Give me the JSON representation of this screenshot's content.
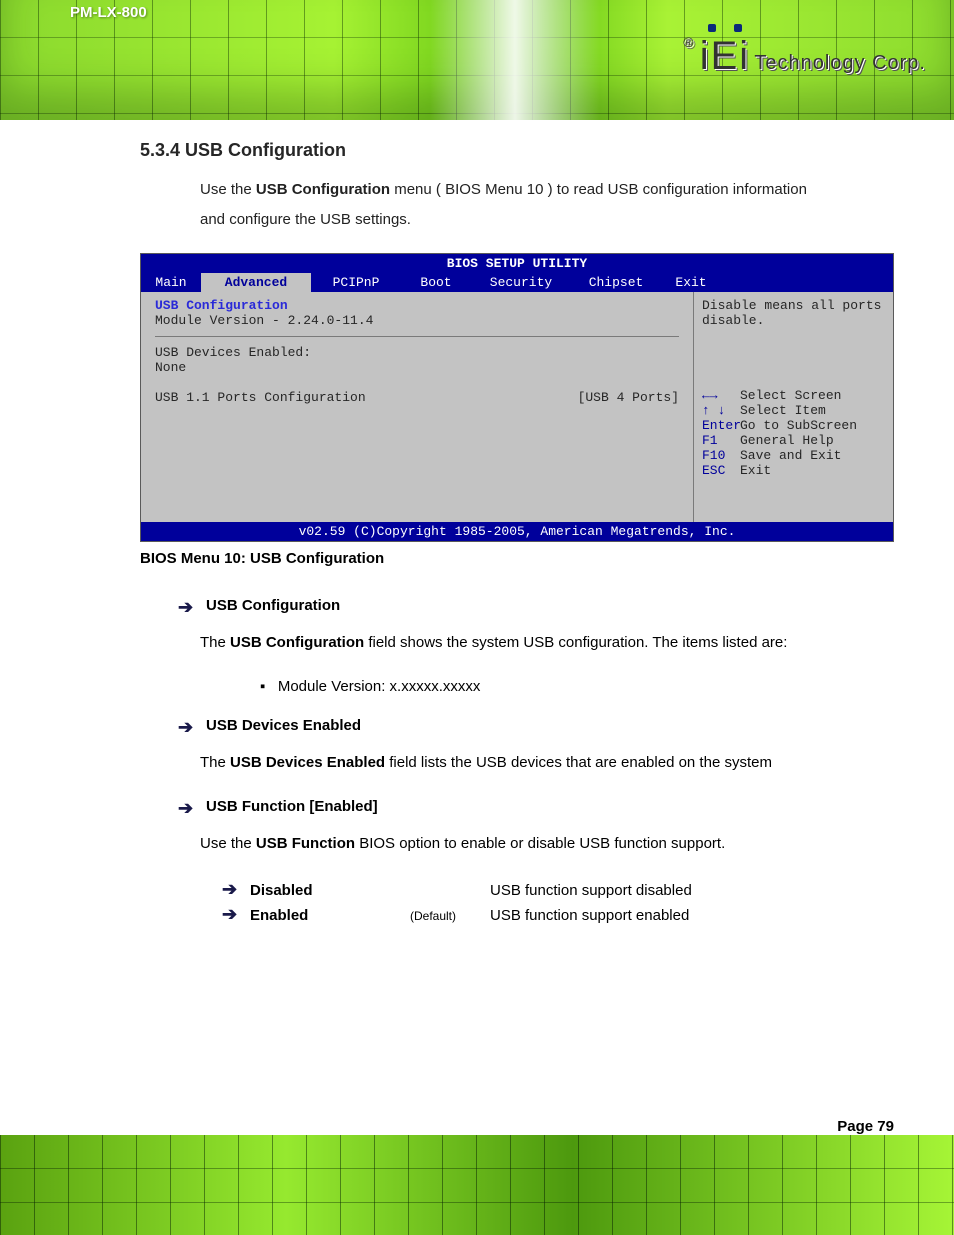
{
  "header": {
    "product": "PM-LX-800",
    "logo_reg": "®",
    "logo_mark": "iEi",
    "logo_tag": "Technology Corp."
  },
  "section_heading": "5.3.4 USB Configuration",
  "intro_pre": "Use the ",
  "intro_bold": "USB Configuration",
  "intro_mid": " menu (",
  "intro_ref": "BIOS Menu 10",
  "intro_post": ") to read USB configuration information and configure the USB settings.",
  "bios": {
    "title": "BIOS SETUP UTILITY",
    "tabs": {
      "main": "Main",
      "advanced": "Advanced",
      "pcipnp": "PCIPnP",
      "boot": "Boot",
      "security": "Security",
      "chipset": "Chipset",
      "exit": "Exit"
    },
    "left_header": "USB Configuration",
    "mod_ver_label": "Module Version - 2.24.0-11.4",
    "dev_label": "USB Devices Enabled:",
    "dev_none": "None",
    "opt_name": "USB 1.1 Ports Configuration",
    "opt_val": "[USB 4 Ports]",
    "right_desc": "Disable means all ports disable.",
    "nav": {
      "lr": "←→",
      "lr_d": "Select Screen",
      "ud": "↑ ↓",
      "ud_d": "Select Item",
      "enter": "Enter",
      "enter_d": "Go to SubScreen",
      "f1": "F1",
      "f1_d": "General Help",
      "f10": "F10",
      "f10_d": "Save and Exit",
      "esc": "ESC",
      "esc_d": "Exit"
    },
    "foot": "v02.59 (C)Copyright 1985-2005, American Megatrends, Inc."
  },
  "caption": "BIOS Menu 10: USB Configuration",
  "items": {
    "a_title": "USB Configuration",
    "a_pre": "The ",
    "a_bold": "USB Configuration",
    "a_post": " field shows the system USB configuration. The items listed are:",
    "a_bullet": "Module Version: x.xxxxx.xxxxx",
    "b_title": "USB Devices Enabled",
    "b_pre": "The ",
    "b_bold": "USB Devices Enabled",
    "b_post": " field lists the USB devices that are enabled on the system",
    "c_title": "USB Function [Enabled]",
    "c_pre": "Use the ",
    "c_bold": "USB Function",
    "c_post": " BIOS option to enable or disable USB function support.",
    "c_opts": [
      {
        "key": "Disabled",
        "def": "",
        "desc": "USB function support disabled"
      },
      {
        "key": "Enabled",
        "def": "(Default)",
        "desc": "USB function support enabled"
      }
    ]
  },
  "page_label": "Page 79"
}
